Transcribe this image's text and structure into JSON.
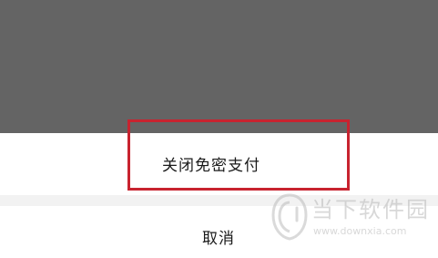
{
  "action_sheet": {
    "primary_action": "关闭免密支付",
    "cancel": "取消"
  },
  "watermark": {
    "name": "当下软件园",
    "url": "www.downxia.com"
  },
  "colors": {
    "overlay": "#646464",
    "highlight_border": "#c8232f",
    "divider": "#f2f2f2",
    "text": "#1a1a1a"
  }
}
